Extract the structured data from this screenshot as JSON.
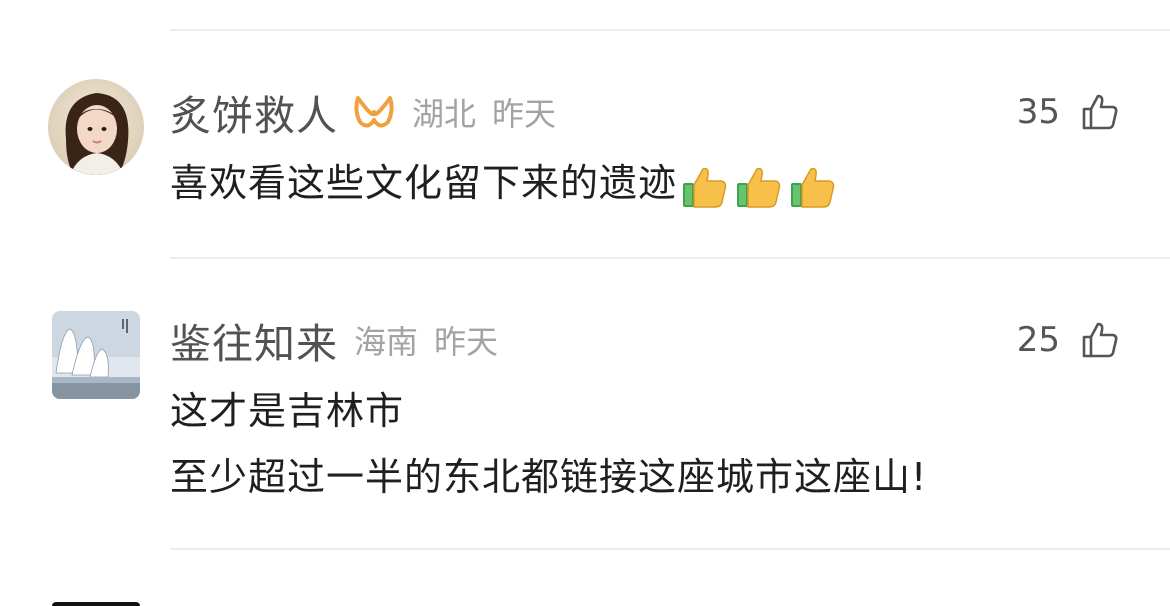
{
  "comments": [
    {
      "username": "炙饼救人",
      "region": "湖北",
      "time": "昨天",
      "likes": "35",
      "content_lines": [
        "喜欢看这些文化留下来的遗迹"
      ],
      "emoji": [
        "thumbs-up-emoji",
        "thumbs-up-emoji",
        "thumbs-up-emoji"
      ],
      "vip_badge": "vip-badge-icon"
    },
    {
      "username": "鉴往知来",
      "region": "海南",
      "time": "昨天",
      "likes": "25",
      "content_lines": [
        "这才是吉林市",
        "至少超过一半的东北都链接这座城市这座山!"
      ]
    }
  ],
  "colors": {
    "username": "#525252",
    "meta": "#a3a3a3",
    "content": "#1f1f1f",
    "divider": "#ececec",
    "vip_badge": "#f0a03c"
  }
}
